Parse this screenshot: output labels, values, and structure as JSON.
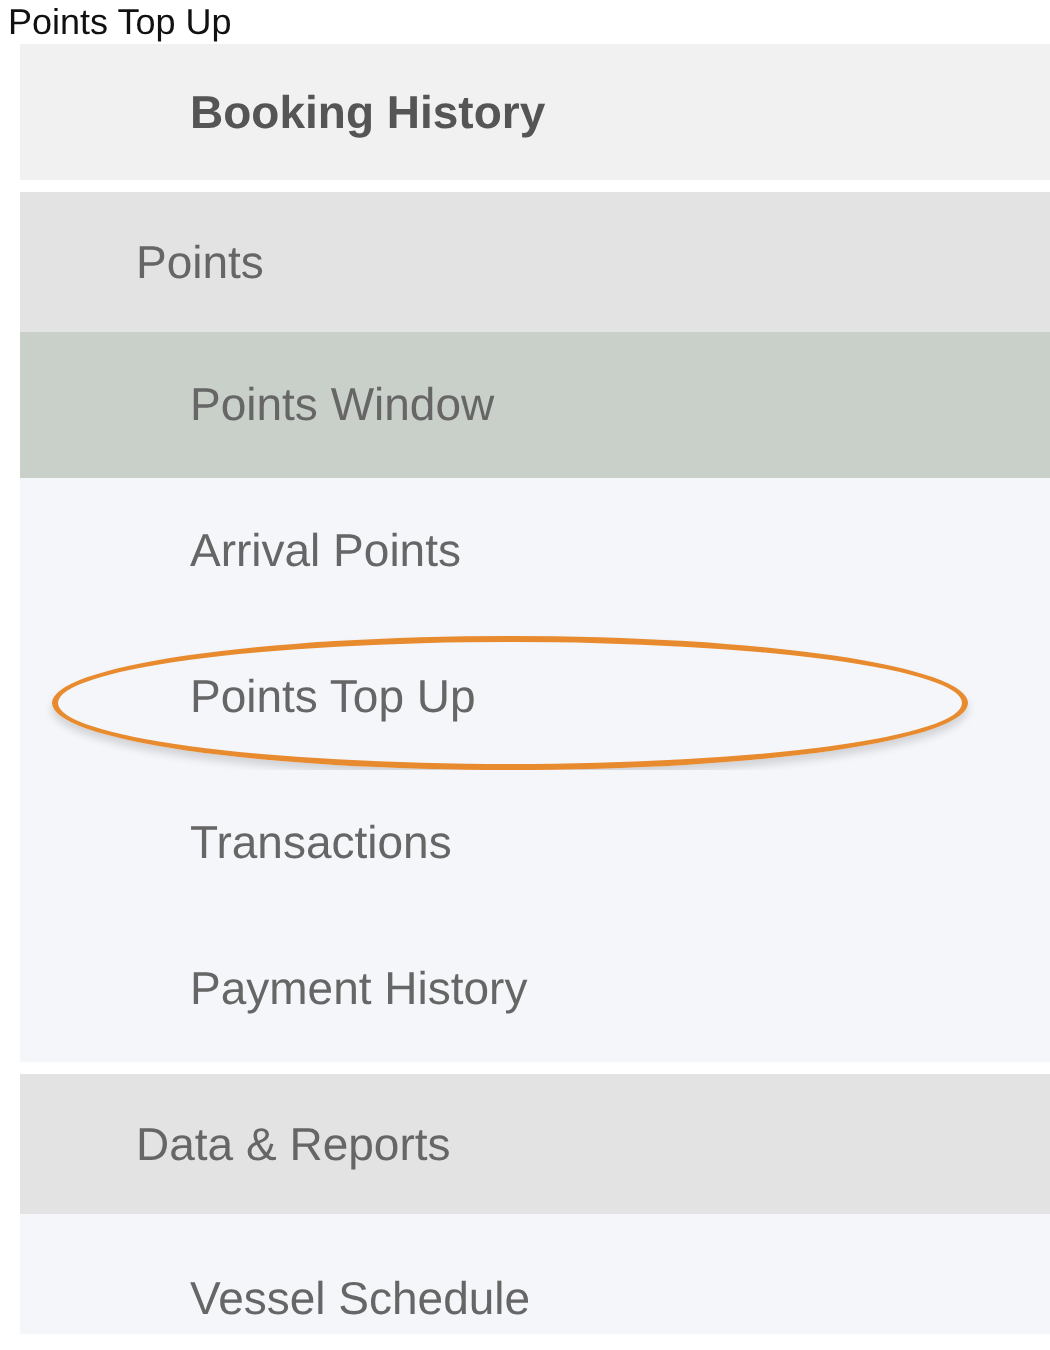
{
  "caption": "Points Top Up",
  "menu": [
    {
      "label": "Booking History",
      "kind": "bold-item",
      "selected": false,
      "circled": false
    },
    {
      "label": "Points",
      "kind": "header",
      "selected": false,
      "circled": false
    },
    {
      "label": "Points Window",
      "kind": "item",
      "selected": true,
      "circled": false
    },
    {
      "label": "Arrival Points",
      "kind": "item",
      "selected": false,
      "circled": false
    },
    {
      "label": "Points Top Up",
      "kind": "item",
      "selected": false,
      "circled": true
    },
    {
      "label": "Transactions",
      "kind": "item",
      "selected": false,
      "circled": false
    },
    {
      "label": "Payment History",
      "kind": "item",
      "selected": false,
      "circled": false
    },
    {
      "label": "Data & Reports",
      "kind": "header",
      "selected": false,
      "circled": false
    },
    {
      "label": "Vessel Schedule",
      "kind": "item",
      "selected": false,
      "circled": false
    }
  ]
}
